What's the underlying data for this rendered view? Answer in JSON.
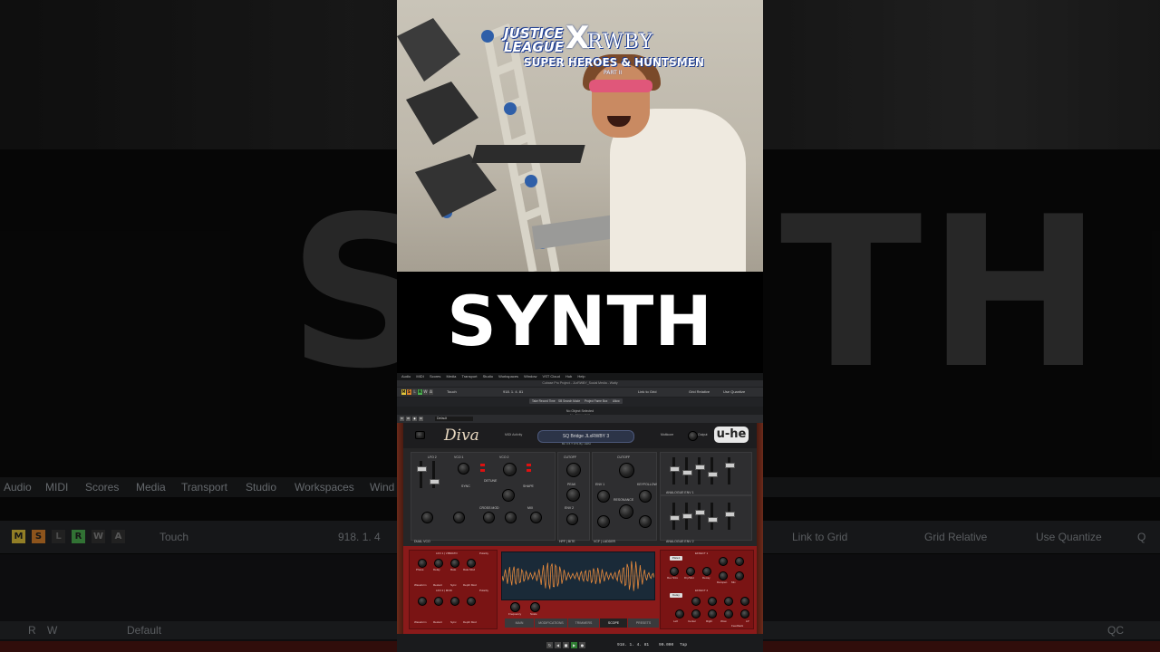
{
  "background": {
    "big_text": "SYNTH",
    "menu": [
      "Audio",
      "MIDI",
      "Scores",
      "Media",
      "Transport",
      "Studio",
      "Workspaces",
      "Wind"
    ],
    "toolbar": {
      "buttons": [
        "M",
        "S",
        "L",
        "R",
        "W",
        "A"
      ],
      "automation_mode": "Touch",
      "position": "918. 1. 4",
      "snap_mode": "Link to Grid",
      "grid_type": "Grid Relative",
      "quantize": "Use Quantize",
      "quantize_icon": "Q"
    },
    "lower_bar": {
      "buttons": [
        "R",
        "W"
      ],
      "preset": "Default",
      "qc": "QC"
    }
  },
  "video": {
    "logo": {
      "line1": "JUSTICE",
      "line2": "LEAGUE",
      "x": "X",
      "rwby": "RWBY",
      "subtitle": "SUPER HEROES & HUNTSMEN",
      "part": "PART II"
    }
  },
  "caption": "SYNTH",
  "daw": {
    "menu": [
      "Audio",
      "MIDI",
      "Scores",
      "Media",
      "Transport",
      "Studio",
      "Workspaces",
      "Window",
      "VST Cloud",
      "Hub",
      "Help"
    ],
    "window_title": "Cubase Pro Project - JLxRWBY_Social Media - Watty",
    "toolbar": {
      "automation_mode": "Touch",
      "position": "918. 1. 4. 81",
      "snap_mode": "Link to Grid",
      "grid_type": "Grid Relative",
      "quantize": "Use Quantize"
    },
    "sub_buttons": [
      "Take Record Time",
      "SB Search Mode",
      "Project Fame Box",
      "Allow"
    ],
    "status": "No Object Selected",
    "status2": "1n - Stereo Out2"
  },
  "plugin_window": {
    "buttons": [
      "R",
      "W",
      "◆",
      "⚙"
    ],
    "preset": "Default"
  },
  "diva": {
    "logo": "Diva",
    "midi_activity": "MIDI Activity",
    "patch_name": "SQ Bridge JLxRWBY 3",
    "patch_meta": "Bit: 0.5 T   OT1   By: HWH",
    "multicore": "Multicore",
    "output": "Output",
    "brand": "u-he",
    "sections": {
      "dual_vco": "DUAL VCO",
      "hpf": "HPF | BITE",
      "vcf": "VCF | LADDER",
      "env1": "ANALOGUE ENV 1",
      "env2": "ANALOGUE ENV 2",
      "vco1": "VCO 1",
      "vco2": "VCO 2",
      "lfo2": "LFO 2",
      "cutoff": "CUTOFF",
      "cutoff2": "CUTOFF",
      "peak": "PEAK",
      "shape": "SHAPE",
      "mix": "MIX",
      "env2_label": "ENV 2",
      "env1_label": "ENV 1",
      "resonance": "RESONANCE",
      "keyfollow": "KEYFOLLOW",
      "cross_mod": "CROSS MOD",
      "detune": "DETUNE",
      "sync": "SYNC"
    },
    "bottom": {
      "lfo1": "LFO 1 | VIBRATO",
      "lfo2": "LFO 2 | MOD",
      "polarity": "Polarity",
      "effect1": "EFFECT 1",
      "effect2": "EFFECT 2",
      "labels_lfo": [
        "Phase",
        "Delay",
        "Rate",
        "Rate Mod"
      ],
      "labels_lfo2": [
        "Waveform",
        "Restart",
        "Sync",
        "Depth Mod"
      ],
      "labels_fx1": [
        "Rev Size",
        "Dry/Wet",
        "Decay",
        "Dampen",
        "Diffusion",
        "Mix"
      ],
      "labels_fx2": [
        "Left",
        "Center",
        "Right",
        "Wow",
        "Feedback",
        "LP"
      ],
      "plate": "Plate1",
      "delay": "Delay",
      "frequency": "Frequency",
      "scale": "Scale"
    },
    "tabs": [
      "MAIN",
      "MODIFICATIONS",
      "TRIMMERS",
      "SCOPE",
      "PRESETS"
    ],
    "active_tab": "SCOPE"
  },
  "transport": {
    "position": "918. 1. 4. 81",
    "tempo": "90.000",
    "tap": "Tap"
  },
  "colors": {
    "diva_red": "#8a1a1a",
    "mute": "#e0c23b",
    "solo": "#d9822b",
    "read": "#4caf50",
    "scope_wave": "#e88a3c"
  }
}
